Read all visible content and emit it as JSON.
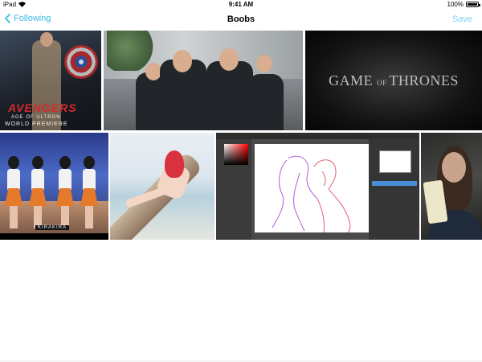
{
  "status_bar": {
    "carrier": "iPad",
    "time": "9:41 AM",
    "battery": "100%",
    "battery_level": 1.0
  },
  "nav_bar": {
    "back_label": "Following",
    "title": "Boobs",
    "save_label": "Save",
    "accent_color": "#3fb8e6"
  },
  "photos": [
    {
      "id": "avengers",
      "subject": "Avengers Age of Ultron world premiere",
      "logo_text": "AVENGERS",
      "sub_text": "AGE OF ULTRON",
      "sub_text2": "WORLD PREMIERE"
    },
    {
      "id": "politicians",
      "subject": "Group of men in suits laughing on street"
    },
    {
      "id": "got",
      "subject": "Game of Thrones title card",
      "title_text": "GAME OF THRONES"
    },
    {
      "id": "kpop",
      "subject": "Girl group performing on stage",
      "tag_text": "KIRAKIRA"
    },
    {
      "id": "beach",
      "subject": "Woman with red hair on palm tree at beach"
    },
    {
      "id": "drawing",
      "subject": "Drawing app with sketch of two figures"
    },
    {
      "id": "selfie",
      "subject": "Woman holding cup in car"
    }
  ]
}
